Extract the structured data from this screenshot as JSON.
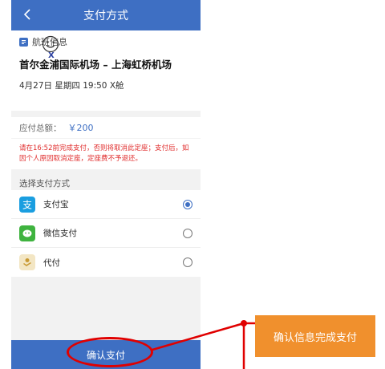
{
  "header": {
    "title": "支付方式"
  },
  "flight": {
    "section_label": "航班信息",
    "route": "首尔金浦国际机场 – 上海虹桥机场",
    "time": "4月27日 星期四 19:50 X舱"
  },
  "payment": {
    "total_label": "应付总额：",
    "total_amount": "￥200",
    "notice": "请在16:52前完成支付，否则将取消此定座；支付后，如因个人原因取消定座，定座费不予退还。",
    "method_label": "选择支付方式",
    "methods": [
      {
        "name": "支付宝",
        "icon": "alipay-icon",
        "color": "#1a9ee0",
        "selected": true
      },
      {
        "name": "微信支付",
        "icon": "wechat-icon",
        "color": "#3fb33f",
        "selected": false
      },
      {
        "name": "代付",
        "icon": "pay-for-other-icon",
        "color": "#d4a640",
        "selected": false
      }
    ]
  },
  "confirm_button": {
    "label": "确认支付"
  },
  "annotation": {
    "callout_text": "确认信息完成支付"
  },
  "colors": {
    "primary": "#3e6fc3",
    "notice": "#e02b2b",
    "annotation": "#e00000",
    "callout": "#f0902d"
  }
}
